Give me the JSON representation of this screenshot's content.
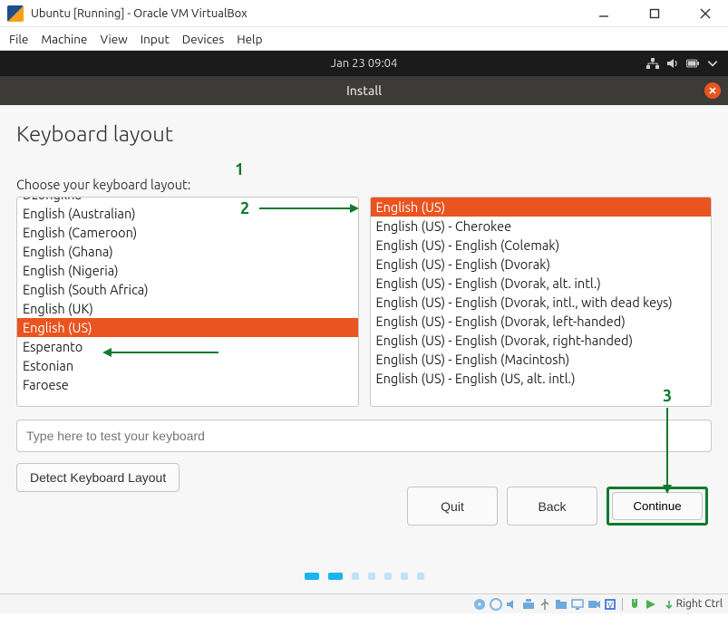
{
  "vb": {
    "title": "Ubuntu [Running] - Oracle VM VirtualBox",
    "menu": {
      "file": "File",
      "machine": "Machine",
      "view": "View",
      "input": "Input",
      "devices": "Devices",
      "help": "Help"
    },
    "host_key": "Right Ctrl"
  },
  "panel": {
    "datetime": "Jan 23  09:04"
  },
  "installer": {
    "bar_title": "Install",
    "page_title": "Keyboard layout",
    "subtitle": "Choose your keyboard layout:",
    "test_placeholder": "Type here to test your keyboard",
    "detect_label": "Detect Keyboard Layout",
    "quit": "Quit",
    "back": "Back",
    "continue": "Continue"
  },
  "left_list": {
    "items": [
      "Dzongkha",
      "English (Australian)",
      "English (Cameroon)",
      "English (Ghana)",
      "English (Nigeria)",
      "English (South Africa)",
      "English (UK)",
      "English (US)",
      "Esperanto",
      "Estonian",
      "Faroese"
    ],
    "selected_index": 7
  },
  "right_list": {
    "items": [
      "English (US)",
      "English (US) - Cherokee",
      "English (US) - English (Colemak)",
      "English (US) - English (Dvorak)",
      "English (US) - English (Dvorak, alt. intl.)",
      "English (US) - English (Dvorak, intl., with dead keys)",
      "English (US) - English (Dvorak, left-handed)",
      "English (US) - English (Dvorak, right-handed)",
      "English (US) - English (Macintosh)",
      "English (US) - English (US, alt. intl.)"
    ],
    "selected_index": 0
  },
  "annotations": {
    "one": "1",
    "two": "2",
    "three": "3"
  }
}
